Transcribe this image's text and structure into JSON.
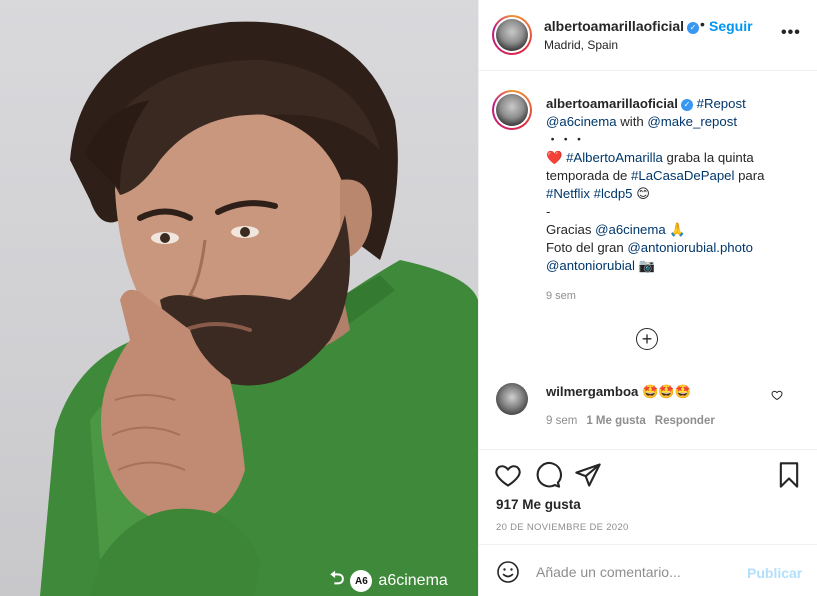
{
  "post": {
    "username": "albertoamarillaoficial",
    "verified_mark": "✓",
    "dot": "•",
    "follow_label": "Seguir",
    "location": "Madrid, Spain",
    "more_label": "•••"
  },
  "caption": {
    "username": "albertoamarillaoficial",
    "repost_tag": "#Repost",
    "mention_1": "@a6cinema",
    "with_text": " with ",
    "mention_2": "@make_repost",
    "separator_1": "・・・",
    "heart": "❤️",
    "tag_actor": "#AlbertoAmarilla",
    "text_1": " graba la quinta temporada de ",
    "tag_show": "#LaCasaDePapel",
    "text_2": " para ",
    "tag_netflix": "#Netflix",
    "tag_lcdp5": "#lcdp5",
    "smile_emoji": "😊",
    "separator_2": "-",
    "thanks_text": "Gracias ",
    "thanks_mention": "@a6cinema",
    "pray_emoji": "🙏",
    "photo_text": "Foto del gran ",
    "photo_mention_1": "@antoniorubial.photo",
    "photo_mention_2": "@antoniorubial",
    "camera_emoji": "📷",
    "time": "9 sem"
  },
  "load_more_label": "+",
  "comment": {
    "username": "wilmergamboa",
    "text": "🤩🤩🤩",
    "time": "9 sem",
    "likes": "1 Me gusta",
    "reply": "Responder",
    "like_icon": "heart-outline"
  },
  "actions": {
    "icons": [
      "heart-outline",
      "speech-bubble",
      "paper-plane",
      "bookmark"
    ],
    "likes": "917 Me gusta",
    "date": "20 DE NOVIEMBRE DE 2020"
  },
  "add_comment": {
    "placeholder": "Añade un comentario...",
    "publish_label": "Publicar"
  },
  "watermark": {
    "repost_icon": "⮌",
    "badge": "A6",
    "brand": "a6cinema"
  },
  "colors": {
    "link": "#00376b",
    "follow": "#0095f6",
    "publish_disabled": "#b2dffc",
    "sweater": "#3f8a3a",
    "background": "#d6d6d9"
  }
}
